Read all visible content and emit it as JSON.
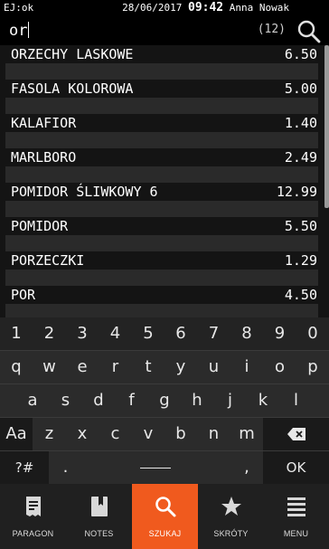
{
  "status": {
    "left": "EJ:ok",
    "date": "28/06/2017",
    "time": "09:42",
    "user": "Anna Nowak"
  },
  "search": {
    "query": "or",
    "count": "(12)",
    "icon": "search-icon"
  },
  "products": [
    {
      "name": "ORZECHY LASKOWE",
      "price": "6.50"
    },
    {
      "name": "FASOLA KOLOROWA",
      "price": "5.00"
    },
    {
      "name": "KALAFIOR",
      "price": "1.40"
    },
    {
      "name": "MARLBORO",
      "price": "2.49"
    },
    {
      "name": "POMIDOR ŚLIWKOWY 6",
      "price": "12.99"
    },
    {
      "name": "POMIDOR",
      "price": "5.50"
    },
    {
      "name": "PORZECZKI",
      "price": "1.29"
    },
    {
      "name": "POR",
      "price": "4.50"
    }
  ],
  "keyboard": {
    "row1": [
      "1",
      "2",
      "3",
      "4",
      "5",
      "6",
      "7",
      "8",
      "9",
      "0"
    ],
    "row2": [
      "q",
      "w",
      "e",
      "r",
      "t",
      "y",
      "u",
      "i",
      "o",
      "p"
    ],
    "row3": [
      "a",
      "s",
      "d",
      "f",
      "g",
      "h",
      "j",
      "k",
      "l"
    ],
    "row4": [
      "z",
      "x",
      "c",
      "v",
      "b",
      "n",
      "m"
    ],
    "shift_label": "Aa",
    "symbols_label": "?#",
    "dot_label": ".",
    "comma_label": ",",
    "ok_label": "OK",
    "backspace_icon": "backspace-icon"
  },
  "nav": [
    {
      "label": "PARAGON",
      "icon": "receipt-icon"
    },
    {
      "label": "NOTES",
      "icon": "notebook-icon"
    },
    {
      "label": "SZUKAJ",
      "icon": "search-icon"
    },
    {
      "label": "SKRÓTY",
      "icon": "star-icon"
    },
    {
      "label": "MENU",
      "icon": "menu-icon"
    }
  ],
  "colors": {
    "accent": "#f05a1e",
    "background": "#151515",
    "row_band": "#2a2a2a",
    "keyboard": "#2b2b2b"
  }
}
